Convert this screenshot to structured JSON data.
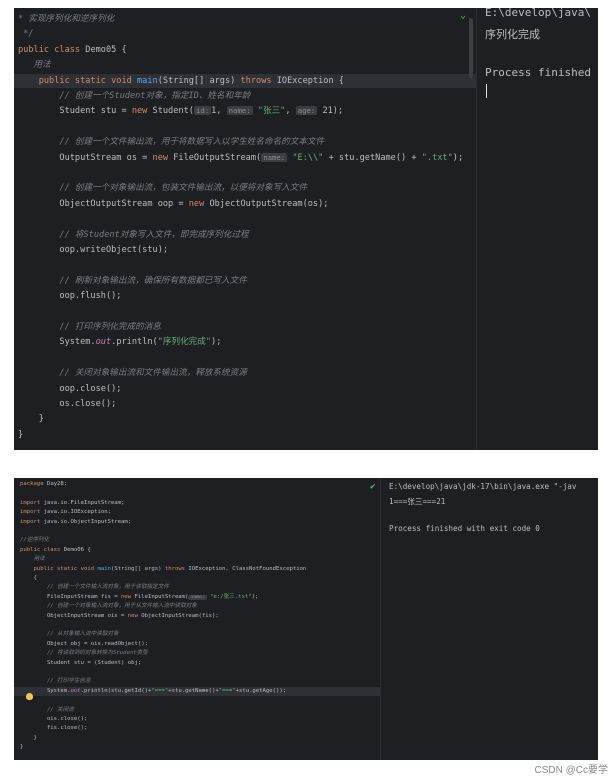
{
  "top": {
    "code_lines": [
      [
        [
          "cm",
          "* 实现序列化和逆序列化"
        ]
      ],
      [
        [
          "cm",
          " */"
        ]
      ],
      [
        [
          "kw",
          "public class "
        ],
        [
          "",
          "Demo05 {"
        ]
      ],
      [
        [
          "cm",
          "   用法"
        ]
      ],
      [
        [
          "kw",
          "    public static void "
        ],
        [
          "fn",
          "main"
        ],
        [
          "",
          "(String[] args) "
        ],
        [
          "kw",
          "throws "
        ],
        [
          "",
          "IOException {"
        ]
      ],
      [
        [
          "cm",
          "        // 创建一个Student对象，指定ID、姓名和年龄"
        ]
      ],
      [
        [
          "",
          "        Student stu = "
        ],
        [
          "kw",
          "new "
        ],
        [
          "",
          "Student("
        ],
        [
          "hint",
          "id:"
        ],
        [
          "",
          "1, "
        ],
        [
          "hint",
          "name:"
        ],
        [
          "st",
          " \"张三\""
        ],
        [
          "",
          ", "
        ],
        [
          "hint",
          "age:"
        ],
        [
          "",
          " 21);"
        ]
      ],
      [
        [
          "",
          ""
        ]
      ],
      [
        [
          "cm",
          "        // 创建一个文件输出流，用于将数据写入以学生姓名命名的文本文件"
        ]
      ],
      [
        [
          "",
          "        OutputStream os = "
        ],
        [
          "kw",
          "new "
        ],
        [
          "",
          "FileOutputStream("
        ],
        [
          "hint",
          "name:"
        ],
        [
          "st",
          " \"E:\\\\\" "
        ],
        [
          "",
          "+ stu.getName() + "
        ],
        [
          "st",
          "\".txt\""
        ],
        [
          "",
          ");"
        ]
      ],
      [
        [
          "",
          ""
        ]
      ],
      [
        [
          "cm",
          "        // 创建一个对象输出流，包装文件输出流，以便将对象写入文件"
        ]
      ],
      [
        [
          "",
          "        ObjectOutputStream oop = "
        ],
        [
          "kw",
          "new "
        ],
        [
          "",
          "ObjectOutputStream(os);"
        ]
      ],
      [
        [
          "",
          ""
        ]
      ],
      [
        [
          "cm",
          "        // 将Student对象写入文件，即完成序列化过程"
        ]
      ],
      [
        [
          "",
          "        oop.writeObject(stu);"
        ]
      ],
      [
        [
          "",
          ""
        ]
      ],
      [
        [
          "cm",
          "        // 刷新对象输出流，确保所有数据都已写入文件"
        ]
      ],
      [
        [
          "",
          "        oop.flush();"
        ]
      ],
      [
        [
          "",
          ""
        ]
      ],
      [
        [
          "cm",
          "        // 打印序列化完成的消息"
        ]
      ],
      [
        [
          "",
          "        System."
        ],
        [
          "fd",
          "out"
        ],
        [
          "",
          ".println("
        ],
        [
          "st",
          "\"序列化完成\""
        ],
        [
          "",
          ");"
        ]
      ],
      [
        [
          "",
          ""
        ]
      ],
      [
        [
          "cm",
          "        // 关闭对象输出流和文件输出流，释放系统资源"
        ]
      ],
      [
        [
          "",
          "        oop.close();"
        ]
      ],
      [
        [
          "",
          "        os.close();"
        ]
      ],
      [
        [
          "",
          "    }"
        ]
      ],
      [
        [
          "",
          "}"
        ]
      ]
    ],
    "console_lines": [
      "E:\\develop\\java\\",
      "序列化完成",
      "",
      "Process finished"
    ]
  },
  "bottom": {
    "code_lines": [
      [
        [
          "kw",
          "package "
        ],
        [
          "",
          "Day28;"
        ]
      ],
      [
        [
          "",
          ""
        ]
      ],
      [
        [
          "kw",
          "import "
        ],
        [
          "",
          "java.io.FileInputStream;"
        ]
      ],
      [
        [
          "kw",
          "import "
        ],
        [
          "",
          "java.io.IOException;"
        ]
      ],
      [
        [
          "kw",
          "import "
        ],
        [
          "",
          "java.io.ObjectInputStream;"
        ]
      ],
      [
        [
          "",
          ""
        ]
      ],
      [
        [
          "cm",
          "//逆序列化"
        ]
      ],
      [
        [
          "kw",
          "public class "
        ],
        [
          "",
          "Demo06 {"
        ]
      ],
      [
        [
          "cm",
          "    用法"
        ]
      ],
      [
        [
          "kw",
          "    public static void "
        ],
        [
          "fn",
          "main"
        ],
        [
          "",
          "(String[] args) "
        ],
        [
          "kw",
          "throws "
        ],
        [
          "",
          "IOException, ClassNotFoundException"
        ]
      ],
      [
        [
          "",
          "    {"
        ]
      ],
      [
        [
          "cm",
          "        // 创建一个文件输入流对象，用于读取指定文件"
        ]
      ],
      [
        [
          "",
          "        FileInputStream fis = "
        ],
        [
          "kw",
          "new "
        ],
        [
          "",
          "FileInputStream("
        ],
        [
          "hint",
          "name:"
        ],
        [
          "st",
          " \"e:/张三.txt\""
        ],
        [
          "",
          ");"
        ]
      ],
      [
        [
          "cm",
          "        // 创建一个对象输入流对象，用于从文件输入流中读取对象"
        ]
      ],
      [
        [
          "",
          "        ObjectInputStream ois = "
        ],
        [
          "kw",
          "new "
        ],
        [
          "",
          "ObjectInputStream(fis);"
        ]
      ],
      [
        [
          "",
          ""
        ]
      ],
      [
        [
          "cm",
          "        // 从对象输入流中读取对象"
        ]
      ],
      [
        [
          "",
          "        Object obj = ois.readObject();"
        ]
      ],
      [
        [
          "cm",
          "        // 将读取到的对象转换为Student类型"
        ]
      ],
      [
        [
          "",
          "        Student stu = (Student) obj;"
        ]
      ],
      [
        [
          "",
          ""
        ]
      ],
      [
        [
          "cm",
          "        // 打印学生信息"
        ]
      ],
      [
        [
          "",
          "        System."
        ],
        [
          "fd",
          "out"
        ],
        [
          "",
          ".println(stu.getId()+"
        ],
        [
          "st",
          "\"===\""
        ],
        [
          "",
          "+stu.getName()+"
        ],
        [
          "st",
          "\"===\""
        ],
        [
          "",
          "+stu.getAge());"
        ]
      ],
      [
        [
          "",
          ""
        ]
      ],
      [
        [
          "cm",
          "        // 关闭流"
        ]
      ],
      [
        [
          "",
          "        ois.close();"
        ]
      ],
      [
        [
          "",
          "        fis.close();"
        ]
      ],
      [
        [
          "",
          "    }"
        ]
      ],
      [
        [
          "",
          "}"
        ]
      ]
    ],
    "console_lines": [
      "E:\\develop\\java\\jdk-17\\bin\\java.exe \"-jav",
      "1===张三===21",
      "",
      "Process finished with exit code 0"
    ]
  },
  "watermark": "CSDN @Cc要学",
  "icons": {
    "check": "✔",
    "fold": "-",
    "bulb": "bulb-icon"
  },
  "colors": {
    "keyword": "#cf8e6d",
    "comment": "#7a7e85",
    "string": "#6aab73",
    "method": "#56a8f5",
    "field": "#c77dbb",
    "bg": "#1e1f22"
  }
}
